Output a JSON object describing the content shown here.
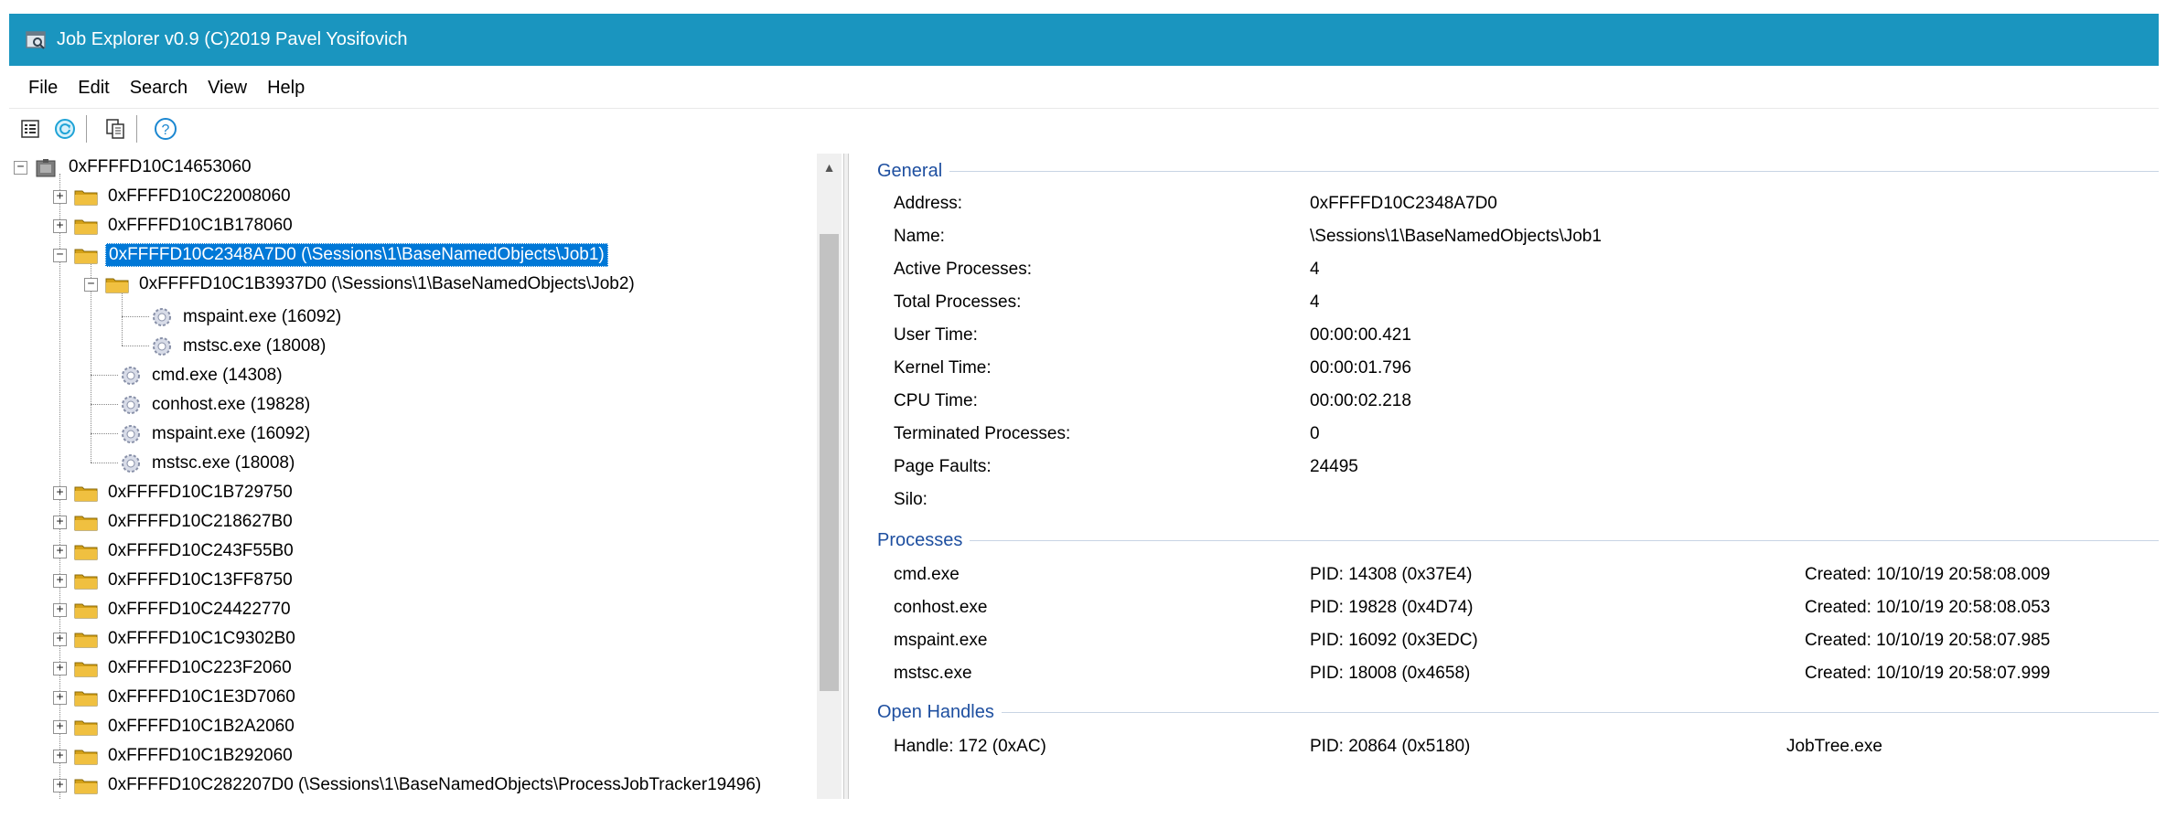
{
  "window": {
    "title": "Job Explorer v0.9 (C)2019 Pavel Yosifovich",
    "accent_color": "#1a95bf"
  },
  "menu": [
    "File",
    "Edit",
    "Search",
    "View",
    "Help"
  ],
  "toolbar": {
    "icons": [
      "properties-icon",
      "refresh-icon",
      "copy-icon",
      "help-icon"
    ]
  },
  "tree": {
    "root": "0xFFFFD10C14653060",
    "items": [
      "0xFFFFD10C22008060",
      "0xFFFFD10C1B178060",
      "0xFFFFD10C2348A7D0 (\\Sessions\\1\\BaseNamedObjects\\Job1)",
      "0xFFFFD10C1B3937D0 (\\Sessions\\1\\BaseNamedObjects\\Job2)",
      "mspaint.exe (16092)",
      "mstsc.exe (18008)",
      "cmd.exe (14308)",
      "conhost.exe (19828)",
      "mspaint.exe (16092)",
      "mstsc.exe (18008)",
      "0xFFFFD10C1B729750",
      "0xFFFFD10C218627B0",
      "0xFFFFD10C243F55B0",
      "0xFFFFD10C13FF8750",
      "0xFFFFD10C24422770",
      "0xFFFFD10C1C9302B0",
      "0xFFFFD10C223F2060",
      "0xFFFFD10C1E3D7060",
      "0xFFFFD10C1B2A2060",
      "0xFFFFD10C1B292060",
      "0xFFFFD10C282207D0 (\\Sessions\\1\\BaseNamedObjects\\ProcessJobTracker19496)"
    ]
  },
  "details": {
    "general_title": "General",
    "general": [
      {
        "label": "Address:",
        "value": "0xFFFFD10C2348A7D0"
      },
      {
        "label": "Name:",
        "value": "\\Sessions\\1\\BaseNamedObjects\\Job1"
      },
      {
        "label": "Active Processes:",
        "value": "4"
      },
      {
        "label": "Total Processes:",
        "value": "4"
      },
      {
        "label": "User Time:",
        "value": "00:00:00.421"
      },
      {
        "label": "Kernel Time:",
        "value": "00:00:01.796"
      },
      {
        "label": "CPU Time:",
        "value": "00:00:02.218"
      },
      {
        "label": "Terminated Processes:",
        "value": "0"
      },
      {
        "label": "Page Faults:",
        "value": "24495"
      },
      {
        "label": "Silo:",
        "value": ""
      }
    ],
    "processes_title": "Processes",
    "processes": [
      {
        "name": "cmd.exe",
        "pid": "PID: 14308 (0x37E4)",
        "created": "Created: 10/10/19 20:58:08.009"
      },
      {
        "name": "conhost.exe",
        "pid": "PID: 19828 (0x4D74)",
        "created": "Created: 10/10/19 20:58:08.053"
      },
      {
        "name": "mspaint.exe",
        "pid": "PID: 16092 (0x3EDC)",
        "created": "Created: 10/10/19 20:58:07.985"
      },
      {
        "name": "mstsc.exe",
        "pid": "PID: 18008 (0x4658)",
        "created": "Created: 10/10/19 20:58:07.999"
      }
    ],
    "handles_title": "Open Handles",
    "handles": [
      {
        "handle": "Handle: 172 (0xAC)",
        "pid": "PID: 20864 (0x5180)",
        "process": "JobTree.exe"
      }
    ]
  }
}
